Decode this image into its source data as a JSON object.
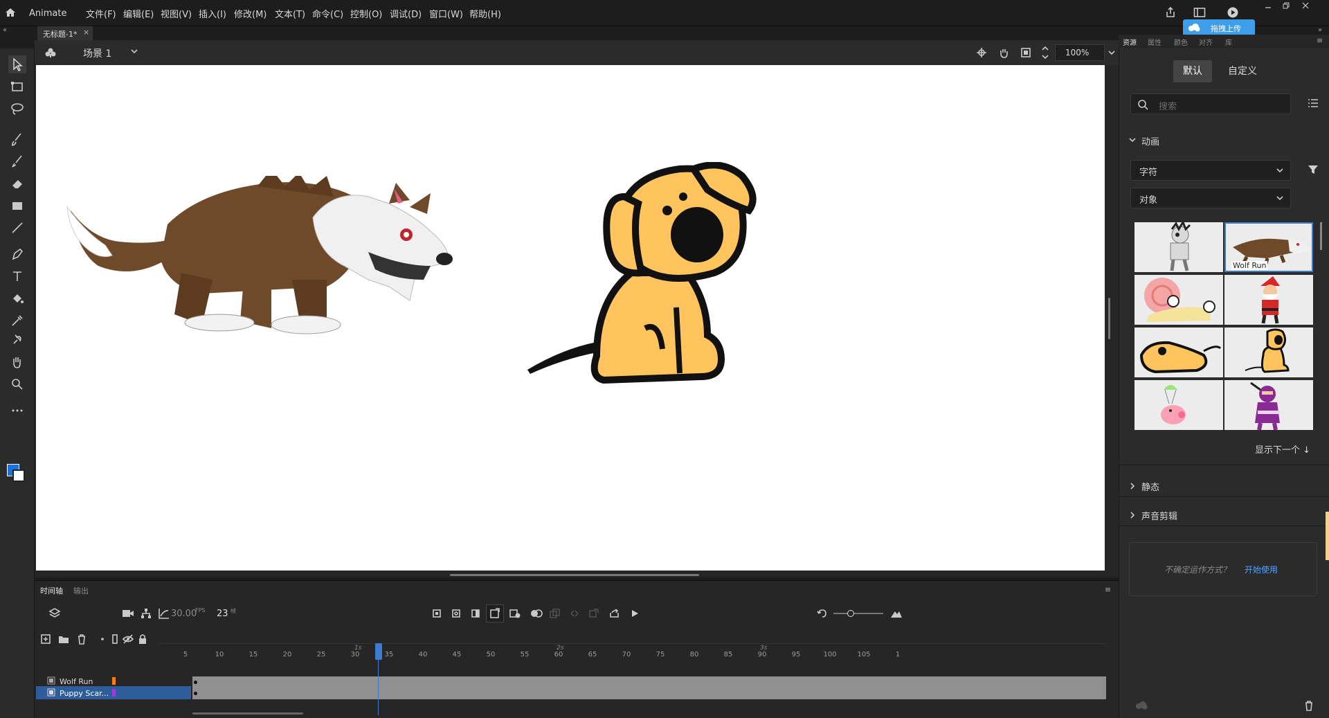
{
  "app": {
    "name": "Animate",
    "menus": [
      "文件(F)",
      "编辑(E)",
      "视图(V)",
      "插入(I)",
      "修改(M)",
      "文本(T)",
      "命令(C)",
      "控制(O)",
      "调试(D)",
      "窗口(W)",
      "帮助(H)"
    ]
  },
  "document": {
    "tab_label": "无标题-1*",
    "scene_label": "场景 1",
    "zoom": "100%"
  },
  "upload_badge": "拖拽上传",
  "right_panel": {
    "tabs": [
      "资源",
      "属性",
      "颜色",
      "对齐",
      "库"
    ],
    "segments": {
      "default": "默认",
      "custom": "自定义"
    },
    "search_placeholder": "搜索",
    "section_animation": "动画",
    "dropdown_type": "字符",
    "dropdown_object": "对象",
    "asset_label_selected": "Wolf Run",
    "show_next": "显示下一个",
    "section_static": "静态",
    "section_sound": "声音剪辑",
    "help_text": "不确定运作方式？",
    "help_link": "开始使用"
  },
  "timeline": {
    "tab_timeline": "时间轴",
    "tab_output": "输出",
    "fps": "30.00",
    "fps_unit": "FPS",
    "current_frame": "23",
    "frame_unit": "帧",
    "seconds_marks": [
      "1s",
      "2s",
      "3s"
    ],
    "ruler_numbers": [
      "5",
      "10",
      "15",
      "20",
      "25",
      "30",
      "35",
      "40",
      "45",
      "50",
      "55",
      "60",
      "65",
      "70",
      "75",
      "80",
      "85",
      "90",
      "95",
      "100",
      "105",
      "1"
    ],
    "layers": [
      {
        "name": "Wolf Run",
        "color": "#ff7f00",
        "selected": false
      },
      {
        "name": "Puppy Scar...",
        "color": "#9b3bdc",
        "selected": true
      }
    ]
  },
  "colors": {
    "accent": "#3a7ccf",
    "stroke_color": "#1473e6",
    "dog_yellow": "#ffc45e",
    "wolf_brown": "#6f4a2a"
  }
}
